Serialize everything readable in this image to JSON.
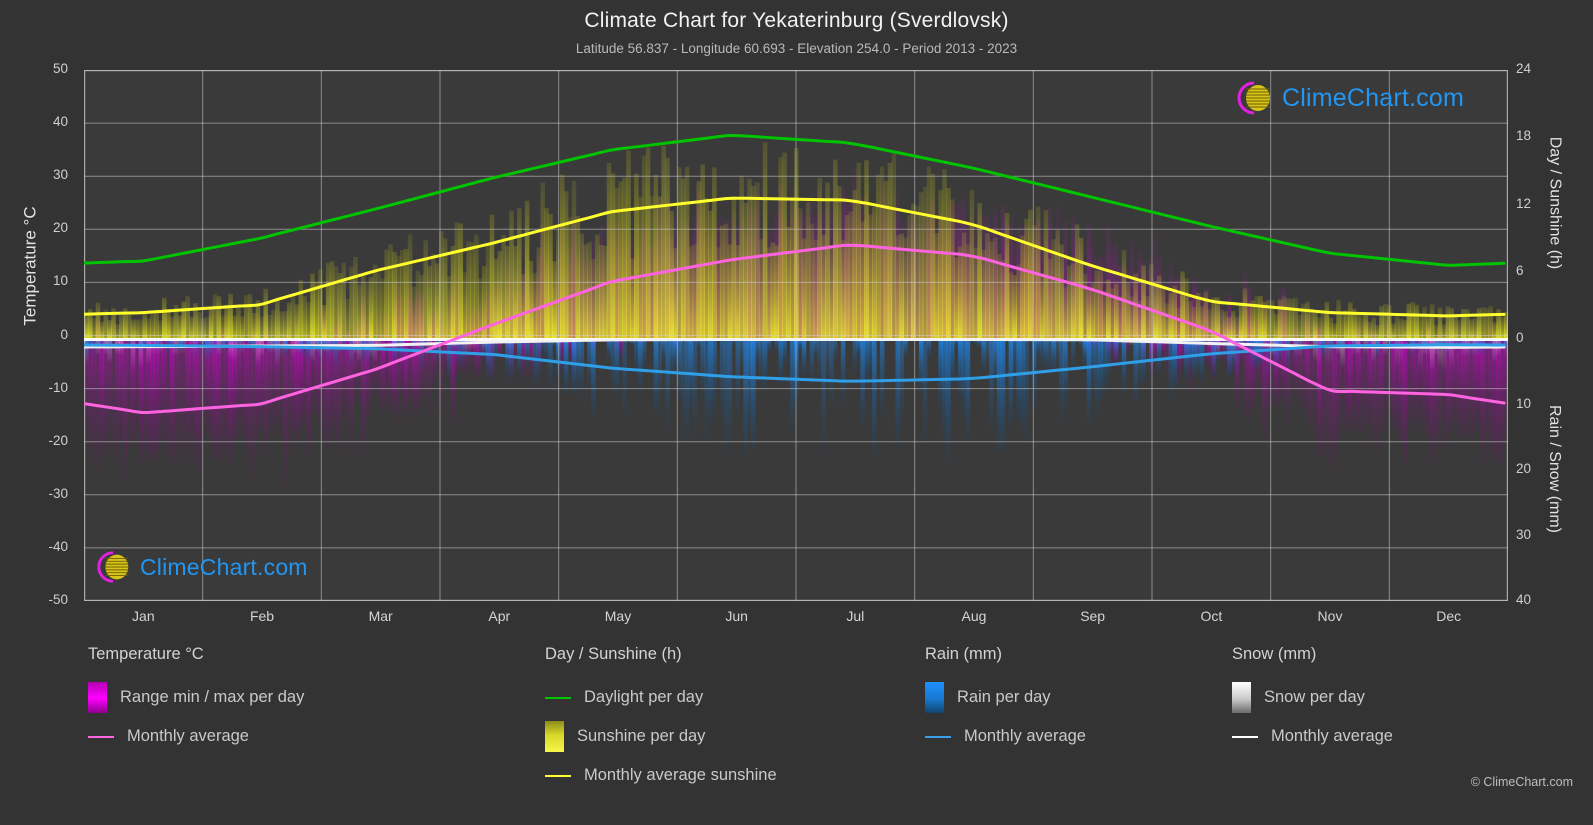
{
  "header": {
    "title": "Climate Chart for Yekaterinburg (Sverdlovsk)",
    "subtitle": "Latitude 56.837 - Longitude 60.693 - Elevation 254.0 - Period 2013 - 2023"
  },
  "axes": {
    "y_left_title": "Temperature °C",
    "y_right_title_top": "Day / Sunshine (h)",
    "y_right_title_bottom": "Rain / Snow (mm)",
    "y_left_ticks": [
      "50",
      "40",
      "30",
      "20",
      "10",
      "0",
      "-10",
      "-20",
      "-30",
      "-40",
      "-50"
    ],
    "y_right_top_ticks": [
      "24",
      "18",
      "12",
      "6",
      "0"
    ],
    "y_right_bottom_ticks": [
      "0",
      "10",
      "20",
      "30",
      "40"
    ],
    "x_ticks": [
      "Jan",
      "Feb",
      "Mar",
      "Apr",
      "May",
      "Jun",
      "Jul",
      "Aug",
      "Sep",
      "Oct",
      "Nov",
      "Dec"
    ]
  },
  "legend": {
    "temperature": {
      "heading": "Temperature °C",
      "items": [
        {
          "label": "Range min / max per day",
          "marker": "gradient-box",
          "color": "#ff00ff"
        },
        {
          "label": "Monthly average",
          "marker": "line",
          "color": "#ff66e0"
        }
      ]
    },
    "daysunshine": {
      "heading": "Day / Sunshine (h)",
      "items": [
        {
          "label": "Daylight per day",
          "marker": "line",
          "color": "#00c800"
        },
        {
          "label": "Sunshine per day",
          "marker": "gradient-box",
          "color": "#eeee33"
        },
        {
          "label": "Monthly average sunshine",
          "marker": "line",
          "color": "#ffff33"
        }
      ]
    },
    "rain": {
      "heading": "Rain (mm)",
      "items": [
        {
          "label": "Rain per day",
          "marker": "gradient-box",
          "color": "#1e90ff"
        },
        {
          "label": "Monthly average",
          "marker": "line",
          "color": "#3aa0ee"
        }
      ]
    },
    "snow": {
      "heading": "Snow (mm)",
      "items": [
        {
          "label": "Snow per day",
          "marker": "gradient-box",
          "color": "#ffffff"
        },
        {
          "label": "Monthly average",
          "marker": "line",
          "color": "#ffffff"
        }
      ]
    }
  },
  "watermark": {
    "text": "ClimeChart.com",
    "copyright": "© ClimeChart.com"
  },
  "chart_data": {
    "type": "line",
    "title": "Climate Chart for Yekaterinburg (Sverdlovsk)",
    "subtitle": "Latitude 56.837 - Longitude 60.693 - Elevation 254.0 - Period 2013 - 2023",
    "xlabel": "",
    "ylabel": "Temperature °C",
    "ylabel_right_top": "Day / Sunshine (h)",
    "ylabel_right_bottom": "Rain / Snow (mm)",
    "ylim": [
      -50,
      50
    ],
    "ylim_right_top": [
      0,
      24
    ],
    "ylim_right_bottom": [
      0,
      40
    ],
    "grid": true,
    "legend_position": "below",
    "categories": [
      "Jan",
      "Feb",
      "Mar",
      "Apr",
      "May",
      "Jun",
      "Jul",
      "Aug",
      "Sep",
      "Oct",
      "Nov",
      "Dec"
    ],
    "series": [
      {
        "name": "Daylight per day",
        "unit": "h",
        "color": "#00c800",
        "values": [
          7.0,
          9.0,
          11.6,
          14.4,
          16.9,
          18.2,
          17.5,
          15.3,
          12.7,
          10.1,
          7.7,
          6.6
        ]
      },
      {
        "name": "Monthly average sunshine",
        "unit": "h",
        "color": "#ffff33",
        "values": [
          2.4,
          3.1,
          6.1,
          8.6,
          11.4,
          12.6,
          12.4,
          10.3,
          6.6,
          3.4,
          2.4,
          2.1
        ]
      },
      {
        "name": "Monthly average temperature",
        "unit": "°C",
        "color": "#ff66e0",
        "values": [
          -13.6,
          -12.0,
          -5.6,
          2.8,
          10.8,
          14.8,
          17.6,
          15.6,
          9.4,
          1.7,
          -9.5,
          -10.2
        ]
      },
      {
        "name": "Monthly average rain",
        "unit": "mm",
        "color": "#3aa0ee",
        "values": [
          0.9,
          1.1,
          1.4,
          2.3,
          4.4,
          5.7,
          6.4,
          6.0,
          4.2,
          2.2,
          1.0,
          0.8
        ]
      },
      {
        "name": "Monthly average snow",
        "unit": "mm",
        "color": "#ffffff",
        "values": [
          1.1,
          1.0,
          0.9,
          0.4,
          0.05,
          0.0,
          0.0,
          0.0,
          0.05,
          0.6,
          1.1,
          1.2
        ]
      }
    ],
    "daily_bands": [
      {
        "name": "Range min / max per day (temperature)",
        "color": "#ff00ff",
        "note": "magenta vertical bars spanning daily min to max temperature"
      },
      {
        "name": "Sunshine per day",
        "color": "#eeee33",
        "note": "yellow vertical bars from zero line up to daily sunshine hours"
      },
      {
        "name": "Rain per day",
        "color": "#1e90ff",
        "note": "blue vertical bars below zero line"
      },
      {
        "name": "Snow per day",
        "color": "#ffffff",
        "note": "white/grey vertical bars below zero line"
      }
    ]
  }
}
